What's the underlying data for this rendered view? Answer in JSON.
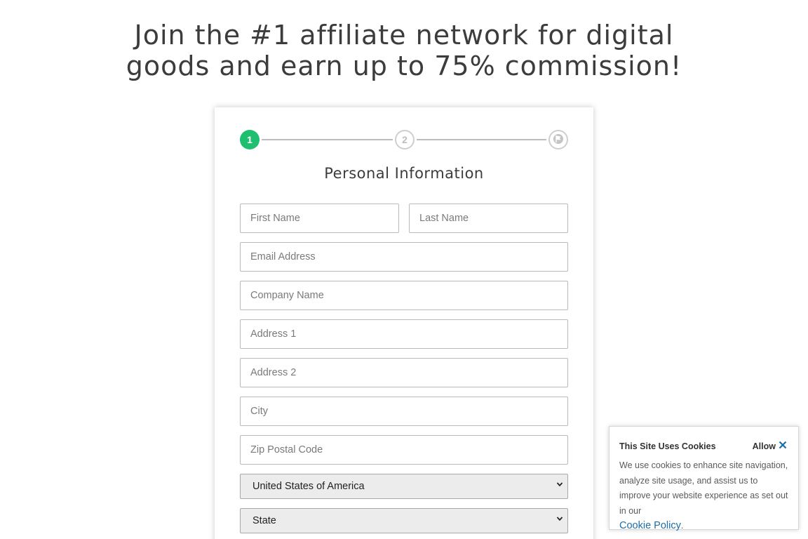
{
  "headline": {
    "line1": "Join the #1 affiliate network for digital",
    "line2": "goods and earn up to 75% commission!"
  },
  "stepper": {
    "steps": [
      {
        "label": "1",
        "state": "active"
      },
      {
        "label": "2",
        "state": "pending"
      },
      {
        "icon": "flag-icon",
        "state": "pending"
      }
    ],
    "active_color": "#1fbf6f"
  },
  "form": {
    "section_title": "Personal Information",
    "first_name": {
      "placeholder": "First Name",
      "value": ""
    },
    "last_name": {
      "placeholder": "Last Name",
      "value": ""
    },
    "email": {
      "placeholder": "Email Address",
      "value": ""
    },
    "company": {
      "placeholder": "Company Name",
      "value": ""
    },
    "address1": {
      "placeholder": "Address 1",
      "value": ""
    },
    "address2": {
      "placeholder": "Address 2",
      "value": ""
    },
    "city": {
      "placeholder": "City",
      "value": ""
    },
    "zip": {
      "placeholder": "Zip Postal Code",
      "value": ""
    },
    "country": {
      "selected": "United States of America"
    },
    "state": {
      "selected": "State"
    }
  },
  "cookie_banner": {
    "title": "This Site Uses Cookies",
    "allow_label": "Allow",
    "body": "We use cookies to enhance site navigation, analyze site usage, and assist us to improve your website experience as set out in our",
    "link_text": "Cookie Policy",
    "link_color": "#1d6ea8"
  }
}
